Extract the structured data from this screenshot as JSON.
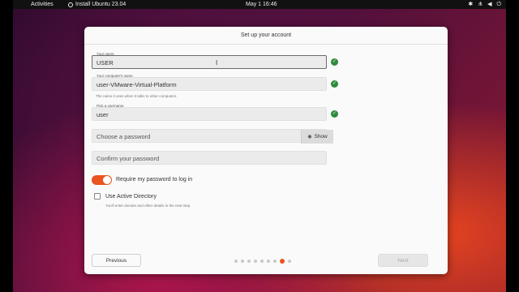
{
  "topbar": {
    "activities": "Activities",
    "app_name": "Install Ubuntu 23.04",
    "clock": "May 1  16:46",
    "tray_icons": [
      "accessibility-icon",
      "network-icon",
      "volume-icon",
      "power-icon"
    ]
  },
  "dialog": {
    "title": "Set up your account",
    "name_field": {
      "caption": "Your name",
      "value": "USER"
    },
    "computer_field": {
      "caption": "Your computer's name",
      "value": "user-VMware-Virtual-Platform"
    },
    "computer_hint": "The name it uses when it talks to other computers.",
    "username_field": {
      "caption": "Pick a username",
      "value": "user"
    },
    "password_field": {
      "placeholder": "Choose a password",
      "show_label": "Show"
    },
    "confirm_field": {
      "placeholder": "Confirm your password"
    },
    "require_password": {
      "label": "Require my password to log in",
      "enabled": true
    },
    "active_directory": {
      "label": "Use Active Directory",
      "hint": "You'll enter domain and other details in the next step.",
      "checked": false
    },
    "previous_label": "Previous",
    "next_label": "Next",
    "progress": {
      "total": 10,
      "current": 8
    }
  },
  "colors": {
    "accent": "#e95420",
    "check": "#2e8b3c"
  }
}
